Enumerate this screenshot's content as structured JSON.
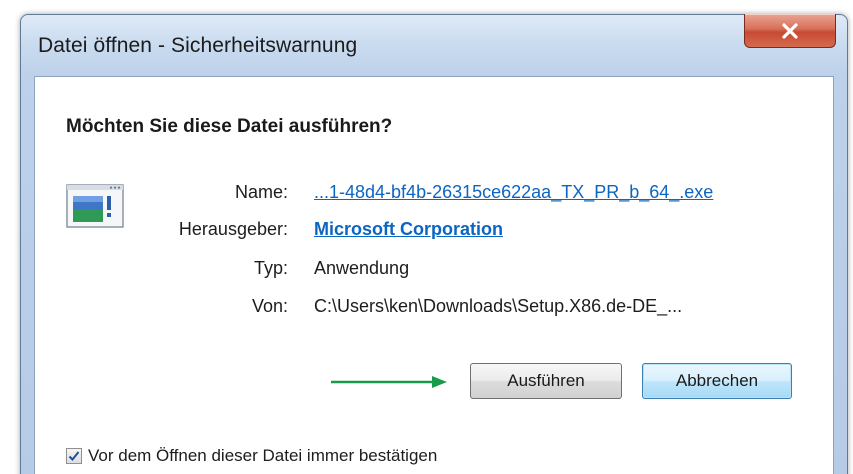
{
  "window": {
    "title": "Datei öffnen - Sicherheitswarnung",
    "close_icon": "close-icon"
  },
  "dialog": {
    "question": "Möchten Sie diese Datei ausführen?",
    "app_icon": "application-icon",
    "fields": {
      "name_label": "Name:",
      "name_value": "...1-48d4-bf4b-26315ce622aa_TX_PR_b_64_.exe",
      "publisher_label": "Herausgeber:",
      "publisher_value": "Microsoft Corporation",
      "type_label": "Typ:",
      "type_value": "Anwendung",
      "from_label": "Von:",
      "from_value": "C:\\Users\\ken\\Downloads\\Setup.X86.de-DE_..."
    },
    "buttons": {
      "run_label": "Ausführen",
      "cancel_label": "Abbrechen"
    },
    "checkbox": {
      "label": "Vor dem Öffnen dieser Datei immer bestätigen",
      "checked": true
    }
  },
  "annotation": {
    "arrow_color": "#1a9b4b"
  },
  "colors": {
    "link": "#0b65c2",
    "close_button": "#c74a33",
    "frame": "#c9dbef"
  }
}
